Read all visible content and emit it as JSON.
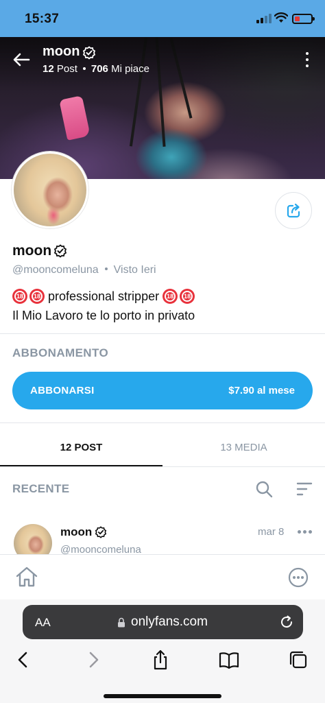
{
  "status_bar": {
    "time": "15:37"
  },
  "header": {
    "name": "moon",
    "posts_count": "12",
    "posts_label": "Post",
    "likes_count": "706",
    "likes_label": "Mi piace"
  },
  "profile": {
    "name": "moon",
    "handle": "@mooncomeluna",
    "last_seen": "Visto Ieri",
    "bio_line1": "professional stripper",
    "bio_line2": "Il Mio Lavoro te lo porto in privato",
    "badge_text": "18"
  },
  "subscription": {
    "heading": "ABBONAMENTO",
    "button_label": "ABBONARSI",
    "price": "$7.90 al mese"
  },
  "tabs": [
    {
      "label": "12 POST",
      "active": true
    },
    {
      "label": "13 MEDIA",
      "active": false
    }
  ],
  "feed": {
    "section_label": "RECENTE",
    "post": {
      "author": "moon",
      "handle": "@mooncomeluna",
      "date": "mar 8"
    }
  },
  "browser": {
    "text_size_label": "AA",
    "url": "onlyfans.com"
  },
  "colors": {
    "status_bar": "#5aa9e6",
    "accent": "#27a8ec",
    "muted": "#8a96a3",
    "badge_red": "#e8323c"
  },
  "icons": [
    "back-arrow-icon",
    "verified-icon",
    "kebab-menu-icon",
    "share-icon",
    "search-icon",
    "sort-icon",
    "more-dots-icon",
    "home-icon",
    "more-circle-icon",
    "lock-icon",
    "reload-icon",
    "browser-back-icon",
    "browser-forward-icon",
    "browser-share-icon",
    "bookmarks-icon",
    "tabs-icon"
  ]
}
